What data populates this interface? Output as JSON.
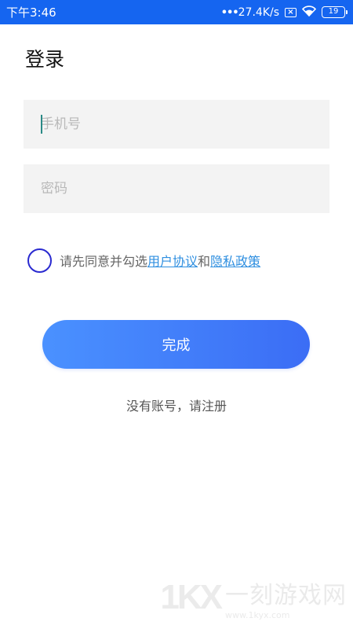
{
  "status_bar": {
    "time": "下午3:46",
    "net_speed": "27.4K/s",
    "sim_icon": "sim-x-icon",
    "wifi_icon": "wifi-icon",
    "battery": "19",
    "background": "#1565f0"
  },
  "page": {
    "title": "登录"
  },
  "form": {
    "phone_placeholder": "手机号",
    "password_placeholder": "密码",
    "agree_prefix": "请先同意并勾选",
    "user_agreement": "用户协议",
    "agree_and": "和",
    "privacy_policy": "隐私政策",
    "submit_label": "完成",
    "register_text": "没有账号，请注册",
    "accent_color": "#2f8fe0",
    "button_gradient": [
      "#4a91ff",
      "#3b6df5"
    ]
  },
  "watermark": {
    "logo": "1KX",
    "name": "一刻游戏网",
    "url": "www.1kyx.com"
  }
}
